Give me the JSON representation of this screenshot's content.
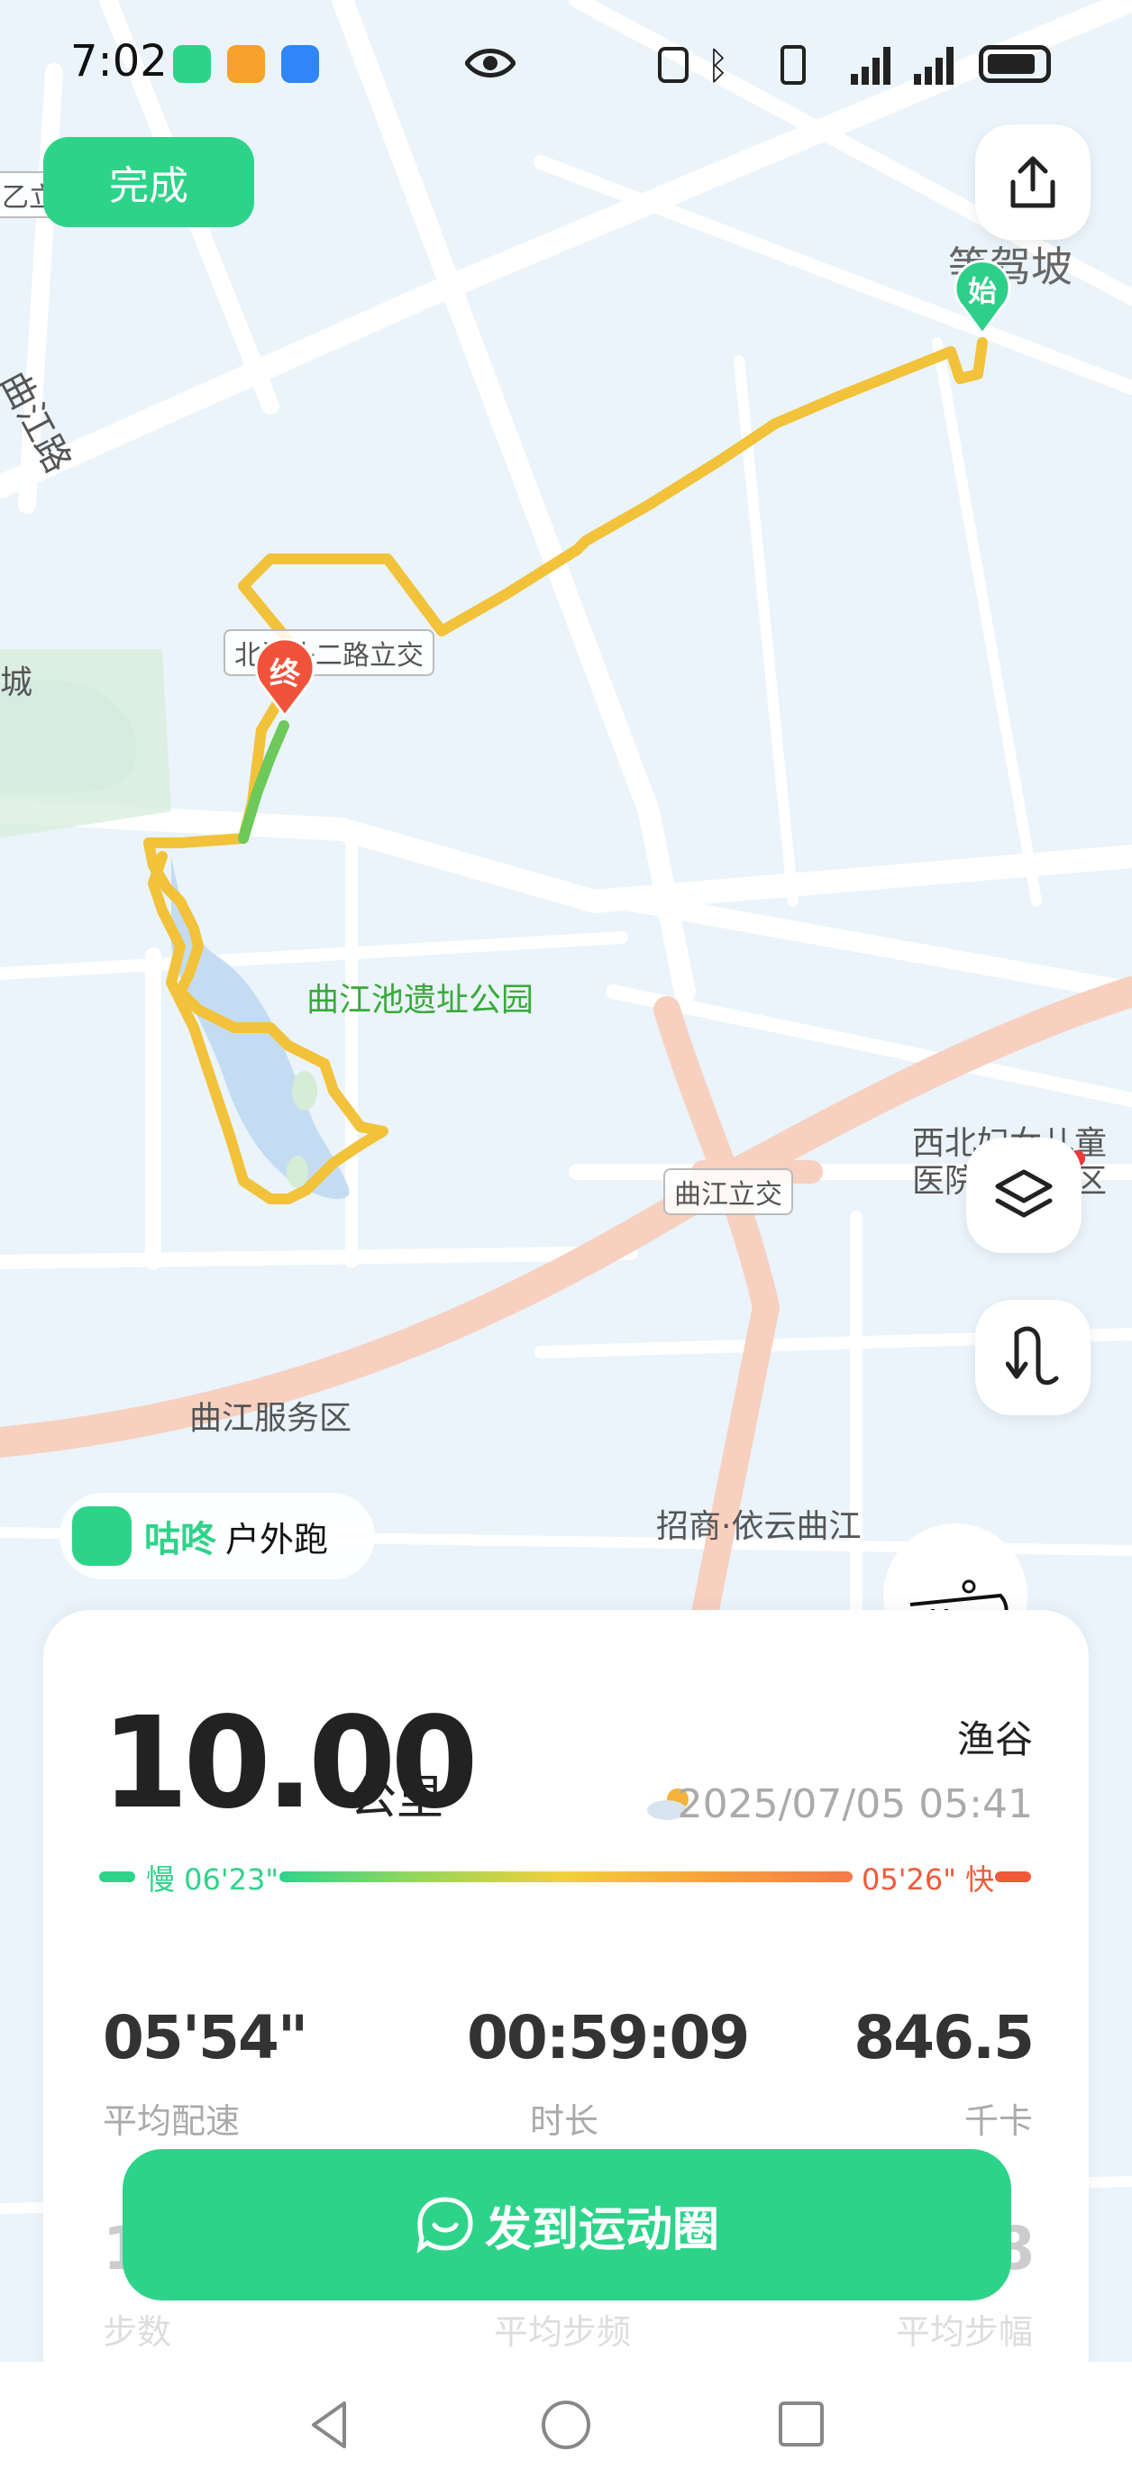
{
  "status_bar": {
    "time": "7:02"
  },
  "header": {
    "done_label": "完成"
  },
  "map": {
    "labels": {
      "road_qujiang": "曲江路",
      "start_area": "等驾坡",
      "interchange_north": "北池头二路立交",
      "park": "曲江池遗址公园",
      "hospital_line1": "西北妇女儿童",
      "hospital_line2": "医院曲江院区",
      "interchange": "曲江立交",
      "service_area": "曲江服务区",
      "estate": "招商·依云曲江",
      "left_edge_top": "乙立",
      "left_edge_city": "城"
    },
    "markers": {
      "start": "始",
      "end": "终"
    }
  },
  "app_badge": {
    "brand": "咕咚",
    "activity": "户外跑"
  },
  "summary": {
    "distance": "10.00",
    "distance_unit": "公里",
    "location": "渔谷",
    "datetime": "2025/07/05 05:41",
    "pace_slow_label": "慢 06'23\"",
    "pace_fast_label": "05'26\" 快",
    "stats": [
      {
        "value": "05'54\"",
        "label": "平均配速"
      },
      {
        "value": "00:59:09",
        "label": "时长"
      },
      {
        "value": "846.5",
        "label": "千卡"
      }
    ],
    "stats_row2": [
      {
        "value": "1",
        "label": "步数"
      },
      {
        "value": "",
        "label": "平均步频"
      },
      {
        "value": "8",
        "label": "平均步幅"
      }
    ]
  },
  "share_button": {
    "label": "发到运动圈"
  },
  "colors": {
    "accent": "#2ed38a",
    "route": "#f2c23a",
    "route_end": "#6cc95a",
    "end_marker": "#f0523a",
    "start_marker": "#2ecf8a"
  }
}
